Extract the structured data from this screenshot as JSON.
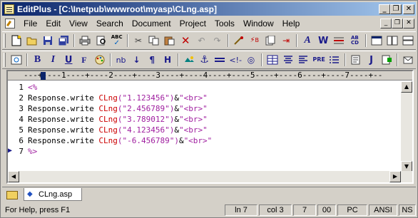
{
  "window": {
    "title": "EditPlus - [C:\\Inetpub\\wwwroot\\myasp\\CLng.asp]"
  },
  "title_buttons": {
    "minimize": "_",
    "restore": "❐",
    "close": "✕"
  },
  "menu": [
    "File",
    "Edit",
    "View",
    "Search",
    "Document",
    "Project",
    "Tools",
    "Window",
    "Help"
  ],
  "toolbar1": {
    "icons": [
      "new-file-icon",
      "open-folder-icon",
      "save-icon",
      "save-all-icon",
      "print-icon",
      "print-preview-icon",
      "spellcheck-icon",
      "cut-icon",
      "copy-icon",
      "paste-icon",
      "delete-icon",
      "undo-icon",
      "redo-icon",
      "find-icon",
      "replace-icon",
      "duplicate-icon",
      "insert-icon",
      "word-wrap-icon",
      "font-icon",
      "line-icon",
      "ruler-icon",
      "columns-icon",
      "window-icon",
      "tile-icon"
    ],
    "spellcheck_label": "ABC"
  },
  "toolbar2": {
    "buttons": [
      "B",
      "I",
      "U",
      "F",
      "nb",
      "↓",
      "¶",
      "H",
      "PRE",
      "J"
    ]
  },
  "ruler": {
    "text": "---+----1----+----2----+----3----+----4----+----5----+----6----+----7----+--"
  },
  "code_lines": [
    {
      "num": "1",
      "tag": "<%",
      "text": ""
    },
    {
      "num": "2",
      "kw": "Response.write ",
      "fn": "CLng",
      "args": "(\"1.123456\")",
      "amp": "&",
      "br": "\"<br>\""
    },
    {
      "num": "3",
      "kw": "Response.write ",
      "fn": "CLng",
      "args": "(\"2.456789\")",
      "amp": "&",
      "br": "\"<br>\""
    },
    {
      "num": "4",
      "kw": "Response.write ",
      "fn": "CLng",
      "args": "(\"3.789012\")",
      "amp": "&",
      "br": "\"<br>\""
    },
    {
      "num": "5",
      "kw": "Response.write ",
      "fn": "CLng",
      "args": "(\"4.123456\")",
      "amp": "&",
      "br": "\"<br>\""
    },
    {
      "num": "6",
      "kw": "Response.write ",
      "fn": "CLng",
      "args": "(\"-6.456789\")",
      "amp": "&",
      "br": "\"<br>\""
    },
    {
      "num": "7",
      "tag": "%>",
      "text": ""
    }
  ],
  "tabs": [
    {
      "label": "CLng.asp"
    }
  ],
  "status": {
    "help": "For Help, press F1",
    "line": "ln 7",
    "col": "col 3",
    "chars": "7",
    "code": "00",
    "mode": "PC",
    "encoding": "ANSI",
    "extra": "NS"
  },
  "colors": {
    "function": "#cc0000",
    "string": "#a020a0",
    "tag": "#a020a0",
    "title_start": "#0a246a"
  }
}
